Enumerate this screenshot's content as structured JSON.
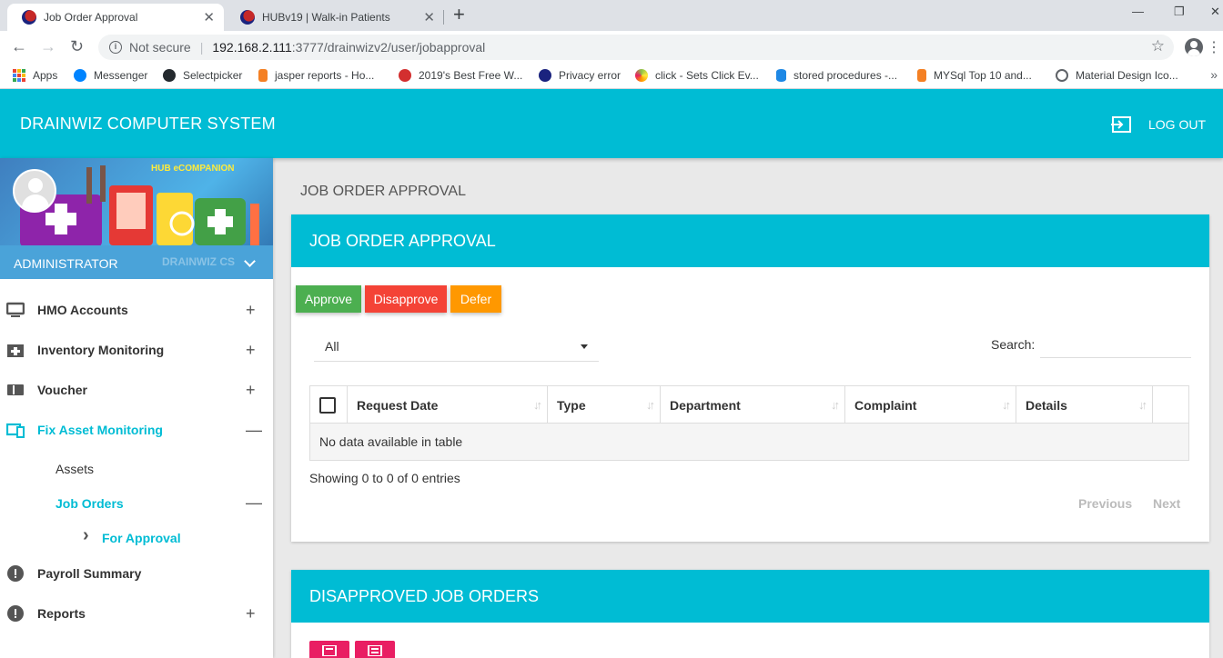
{
  "browser": {
    "tabs": [
      {
        "title": "Job Order Approval",
        "active": true
      },
      {
        "title": "HUBv19 | Walk-in Patients",
        "active": false
      }
    ],
    "new_tab_symbol": "+",
    "window_controls": {
      "minimize": "—",
      "restore": "❐",
      "close": "✕"
    },
    "nav": {
      "back": "←",
      "forward": "→",
      "reload": "↻"
    },
    "security_label": "Not secure",
    "url_host": "192.168.2.111",
    "url_path": ":3777/drainwizv2/user/jobapproval",
    "bookmarks": [
      {
        "label": "Apps",
        "icon": "apps-grid-icon"
      },
      {
        "label": "Messenger",
        "icon": "messenger-icon",
        "color": "#0084ff"
      },
      {
        "label": "Selectpicker",
        "icon": "github-icon",
        "color": "#24292e"
      },
      {
        "label": "jasper reports - Ho...",
        "icon": "stackoverflow-icon",
        "color": "#f48024"
      },
      {
        "label": "2019's Best Free W...",
        "icon": "site-icon",
        "color": "#d32f2f"
      },
      {
        "label": "Privacy error",
        "icon": "warning-icon",
        "color": "#1a237e"
      },
      {
        "label": "click - Sets Click Ev...",
        "icon": "pinwheel-icon",
        "color": "#8bc34a"
      },
      {
        "label": "stored procedures -...",
        "icon": "database-icon",
        "color": "#1e88e5"
      },
      {
        "label": "MYSql Top 10 and...",
        "icon": "stackoverflow-icon",
        "color": "#f48024"
      },
      {
        "label": "Material Design Ico...",
        "icon": "globe-icon",
        "color": "#5f6368"
      }
    ]
  },
  "header": {
    "brand": "DRAINWIZ COMPUTER SYSTEM",
    "logout_label": "LOG OUT",
    "color": "#00bcd4"
  },
  "sidebar": {
    "banner_text": "HUB eCOMPANION",
    "user_name": "ADMINISTRATOR",
    "user_watermark": "DRAINWIZ CS",
    "items": [
      {
        "label": "HMO Accounts",
        "icon": "monitor-icon",
        "toggle": "+"
      },
      {
        "label": "Inventory Monitoring",
        "icon": "inventory-icon",
        "toggle": "+"
      },
      {
        "label": "Voucher",
        "icon": "ticket-icon",
        "toggle": "+"
      },
      {
        "label": "Fix Asset Monitoring",
        "icon": "devices-icon",
        "toggle": "—",
        "active": true
      },
      {
        "label": "Payroll Summary",
        "icon": "alert-circle-icon",
        "toggle": ""
      },
      {
        "label": "Reports",
        "icon": "alert-circle-icon",
        "toggle": "+"
      }
    ],
    "sub_items": {
      "assets": "Assets",
      "job_orders": "Job Orders",
      "job_orders_toggle": "—",
      "for_approval": "For Approval",
      "for_approval_chevron": "›"
    }
  },
  "main": {
    "page_title": "JOB ORDER APPROVAL",
    "card1": {
      "title": "JOB ORDER APPROVAL",
      "buttons": {
        "approve": "Approve",
        "disapprove": "Disapprove",
        "defer": "Defer"
      },
      "filter_value": "All",
      "search_label": "Search:",
      "search_value": "",
      "columns": [
        "Request Date",
        "Type",
        "Department",
        "Complaint",
        "Details"
      ],
      "empty_text": "No data available in table",
      "info": "Showing 0 to 0 of 0 entries",
      "pager": {
        "previous": "Previous",
        "next": "Next"
      }
    },
    "card2": {
      "title": "DISAPPROVED JOB ORDERS",
      "buttons": [
        "pdf-icon",
        "list-icon"
      ]
    }
  }
}
